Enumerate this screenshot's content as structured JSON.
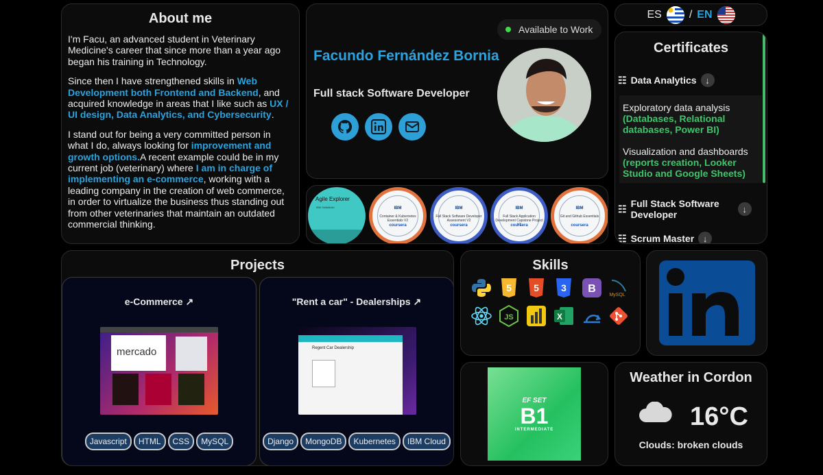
{
  "about": {
    "title": "About me",
    "p1": "I'm Facu, an advanced student in Veterinary Medicine's career that since more than a year ago began his training in Technology.",
    "p2_a": "Since then I have strengthened skills in ",
    "p2_h1": "Web Development both Frontend and Backend",
    "p2_b": ", and acquired knowledge in areas that I like such as ",
    "p2_h2": "UX / UI design, Data Analytics, and Cybersecurity",
    "p2_c": ".",
    "p3_a": "I stand out for being a very committed person in what I do, always looking for ",
    "p3_h1": "improvement and growth options.",
    "p3_b": "A recent example could be in my current job (veterinary) where ",
    "p3_h2": "I am in charge of implementing an e-commerce",
    "p3_c": ", working with a leading company in the creation of web commerce, in order to virtualize the business thus standing out from other veterinaries that maintain an outdated commercial thinking."
  },
  "profile": {
    "status": "Available to Work",
    "name": "Facundo Fernández Bornia",
    "role": "Full stack Software Developer",
    "socials": [
      "github-icon",
      "linkedin-icon",
      "mail-icon"
    ],
    "accent": "#2aa3e0"
  },
  "badges": {
    "agile": {
      "title": "Agile Explorer",
      "sub": "IBM SkillsBuild"
    },
    "items": [
      {
        "name": "Container & Kubernetes Essentials V2",
        "border": "#e2733f"
      },
      {
        "name": "Full Stack Software Developer Assessment V2",
        "border": "#3d5dc4"
      },
      {
        "name": "Full Stack Application Development Capstone Project V2",
        "border": "#3d5dc4"
      },
      {
        "name": "Git and Github Essentials",
        "border": "#e2733f"
      }
    ],
    "network": "IBM Developer Skills Network",
    "powered": "coursera"
  },
  "lang": {
    "es": "ES",
    "sep": "/",
    "en": "EN"
  },
  "certs": {
    "title": "Certificates",
    "items": [
      "Data Analytics",
      "Full Stack Software Developer",
      "Scrum Master"
    ],
    "d1": "Exploratory data analysis",
    "d1g": "(Databases, Relational databases, Power BI)",
    "d2": "Visualization and dashboards",
    "d2g": "(reports creation, Looker Studio and Google Sheets)"
  },
  "projects": {
    "title": "Projects",
    "items": [
      {
        "name": "e-Commerce",
        "tags": [
          "Javascript",
          "HTML",
          "CSS",
          "MySQL"
        ],
        "shot_title": "mercado"
      },
      {
        "name": "\"Rent a car\" - Dealerships",
        "tags": [
          "Django",
          "MongoDB",
          "Kubernetes",
          "IBM Cloud"
        ],
        "shot_title": "Regent Car Dealership"
      }
    ]
  },
  "skills": {
    "title": "Skills",
    "icons": [
      "python-icon",
      "html5-icon",
      "html5-icon",
      "css3-icon",
      "bootstrap-icon",
      "mysql-icon",
      "react-icon",
      "nodejs-icon",
      "powerbi-icon",
      "excel-icon",
      "scrum-icon",
      "git-icon"
    ]
  },
  "ef": {
    "brand": "EF SET",
    "level": "B1",
    "label": "INTERMEDIATE"
  },
  "weather": {
    "title": "Weather in Cordon",
    "temp": "16°C",
    "cond": "Clouds: broken clouds"
  }
}
